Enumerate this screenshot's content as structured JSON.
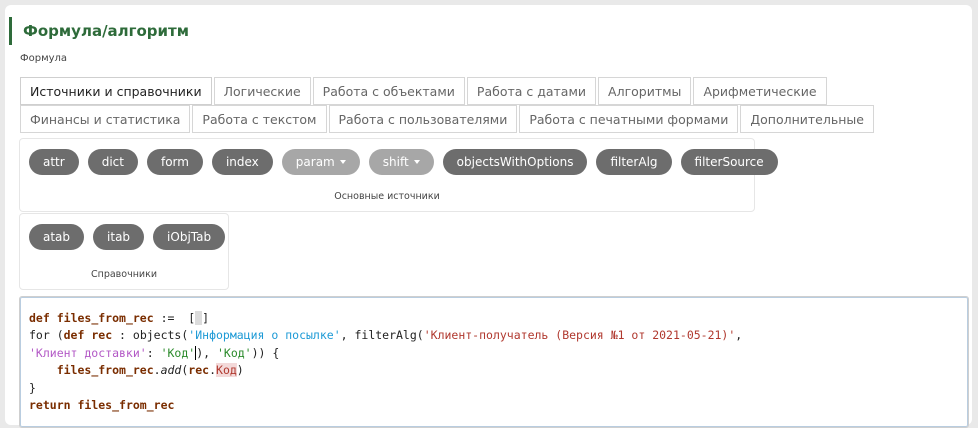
{
  "header": {
    "title": "Формула/алгоритм",
    "field_label": "Формула"
  },
  "tabs_row1": [
    {
      "label": "Источники и справочники",
      "active": true
    },
    {
      "label": "Логические",
      "active": false
    },
    {
      "label": "Работа с объектами",
      "active": false
    },
    {
      "label": "Работа с датами",
      "active": false
    },
    {
      "label": "Алгоритмы",
      "active": false
    },
    {
      "label": "Арифметические",
      "active": false
    }
  ],
  "tabs_row2": [
    {
      "label": "Финансы и статистика",
      "active": false
    },
    {
      "label": "Работа с текстом",
      "active": false
    },
    {
      "label": "Работа с пользователями",
      "active": false
    },
    {
      "label": "Работа с печатными формами",
      "active": false
    },
    {
      "label": "Дополнительные",
      "active": false
    }
  ],
  "main_sources": {
    "label": "Основные источники",
    "buttons": [
      {
        "label": "attr",
        "dropdown": false
      },
      {
        "label": "dict",
        "dropdown": false
      },
      {
        "label": "form",
        "dropdown": false
      },
      {
        "label": "index",
        "dropdown": false
      },
      {
        "label": "param",
        "dropdown": true
      },
      {
        "label": "shift",
        "dropdown": true
      },
      {
        "label": "objectsWithOptions",
        "dropdown": false
      },
      {
        "label": "filterAlg",
        "dropdown": false
      },
      {
        "label": "filterSource",
        "dropdown": false
      }
    ]
  },
  "reference_books": {
    "label": "Справочники",
    "buttons": [
      {
        "label": "atab"
      },
      {
        "label": "itab"
      },
      {
        "label": "iObjTab"
      }
    ]
  },
  "editor": {
    "line1": {
      "kw": "def",
      "name": "files_from_rec",
      "assign": " :=  [",
      "close": "]"
    },
    "line2": {
      "for": "for (",
      "kw": "def",
      "var": "rec",
      "mid": " : objects(",
      "str1": "'Информация о посылке'",
      "mid2": ", filterAlg(",
      "str2": "'Клиент-получатель (Версия №1 от 2021-05-21)'",
      "tail": ","
    },
    "line3": {
      "str1": "'Клиент доставки'",
      "colon": ": ",
      "str2a": "'Код'",
      "cursor_tail": "), ",
      "str3": "'Код'",
      "tail": ")) {"
    },
    "line4": {
      "indent": "    ",
      "obj": "files_from_rec",
      "method": "add",
      "open": "(",
      "rec": "rec",
      "dot": ".",
      "field": "Код",
      "close": ")"
    },
    "line5": "}",
    "line6": {
      "kw": "return",
      "name": "files_from_rec"
    }
  },
  "colors": {
    "title_green": "#2e6b3a",
    "pill_dark": "#6d6d6d",
    "pill_light": "#a7a7a7",
    "string_cyan": "#1d9ad6",
    "string_red": "#b0382e",
    "string_purple": "#b359c6",
    "string_green": "#2a8a2a",
    "keyword_brown": "#7a2d00"
  }
}
